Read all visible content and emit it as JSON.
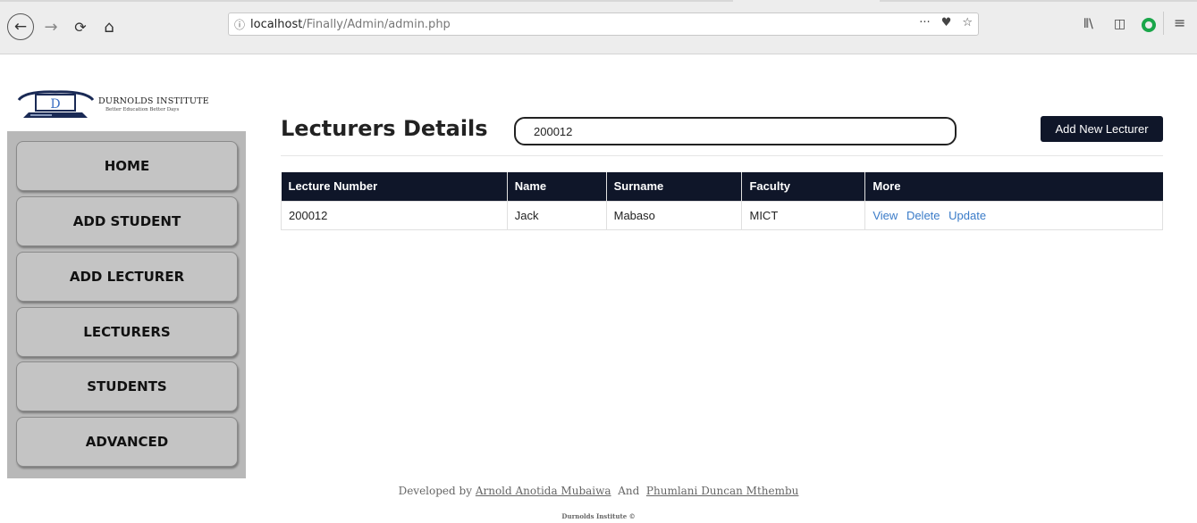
{
  "browser": {
    "url_host": "localhost",
    "url_path": "/Finally/Admin/admin.php",
    "info_icon": "info-icon",
    "back_icon": "←",
    "forward_icon": "→",
    "reload_icon": "⟳",
    "home_icon": "⌂",
    "more_icon": "···",
    "pocket_icon": "♥",
    "bookmark_icon": "☆",
    "library_icon": "⦀\\",
    "sidebar_icon": "◫",
    "menu_icon": "≡"
  },
  "logo": {
    "letter": "D",
    "name": "DURNOLDS INSTITUTE",
    "tagline": "Better Education Better Days"
  },
  "sidebar": {
    "items": [
      {
        "label": "HOME"
      },
      {
        "label": "ADD STUDENT"
      },
      {
        "label": "ADD LECTURER"
      },
      {
        "label": "LECTURERS"
      },
      {
        "label": "STUDENTS"
      },
      {
        "label": "ADVANCED"
      }
    ]
  },
  "main": {
    "title": "Lecturers Details",
    "search_value": "200012",
    "add_button": "Add New Lecturer",
    "columns": [
      "Lecture Number",
      "Name",
      "Surname",
      "Faculty",
      "More"
    ],
    "rows": [
      {
        "number": "200012",
        "name": "Jack",
        "surname": "Mabaso",
        "faculty": "MICT",
        "actions": [
          "View",
          "Delete",
          "Update"
        ]
      }
    ]
  },
  "footer": {
    "prefix": "Developed by",
    "author1": "Arnold Anotida Mubaiwa",
    "joiner": "And",
    "author2": "Phumlani Duncan Mthembu",
    "copyright": "Durnolds Institute ©"
  },
  "colors": {
    "header_dark": "#0f1629",
    "sidebar_bg": "#b8b8b8",
    "link": "#3a7bc8"
  }
}
